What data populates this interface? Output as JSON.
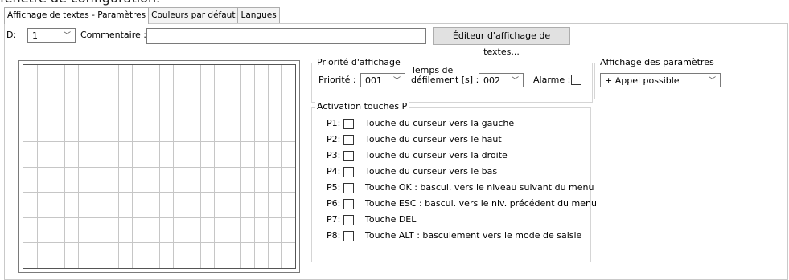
{
  "window_caption": "fenêtre de configuration.",
  "tabs": [
    "Affichage de textes - Paramètres",
    "Couleurs par défaut",
    "Langues"
  ],
  "header": {
    "d_label": "D:",
    "d_value": "1",
    "comment_label": "Commentaire :",
    "comment_value": "",
    "editor_button": "Éditeur d'affichage de textes..."
  },
  "priority": {
    "group_title": "Priorité d'affichage",
    "priority_label": "Priorité :",
    "priority_value": "001",
    "scroll_label_1": "Temps de",
    "scroll_label_2": "défilement [s] :",
    "scroll_value": "002",
    "alarm_label": "Alarme :",
    "alarm_checked": false
  },
  "params": {
    "group_title": "Affichage des paramètres",
    "value": "+ Appel possible"
  },
  "keys": {
    "group_title": "Activation touches P",
    "items": [
      {
        "id": "P1:",
        "label": "Touche du curseur vers la gauche"
      },
      {
        "id": "P2:",
        "label": "Touche du curseur vers le haut"
      },
      {
        "id": "P3:",
        "label": "Touche du curseur vers la droite"
      },
      {
        "id": "P4:",
        "label": "Touche du curseur vers le bas"
      },
      {
        "id": "P5:",
        "label": "Touche OK : bascul. vers le niveau suivant du menu"
      },
      {
        "id": "P6:",
        "label": "Touche ESC : bascul. vers le niv. précédent du menu"
      },
      {
        "id": "P7:",
        "label": "Touche DEL"
      },
      {
        "id": "P8:",
        "label": "Touche ALT : basculement vers le mode de saisie"
      }
    ]
  }
}
